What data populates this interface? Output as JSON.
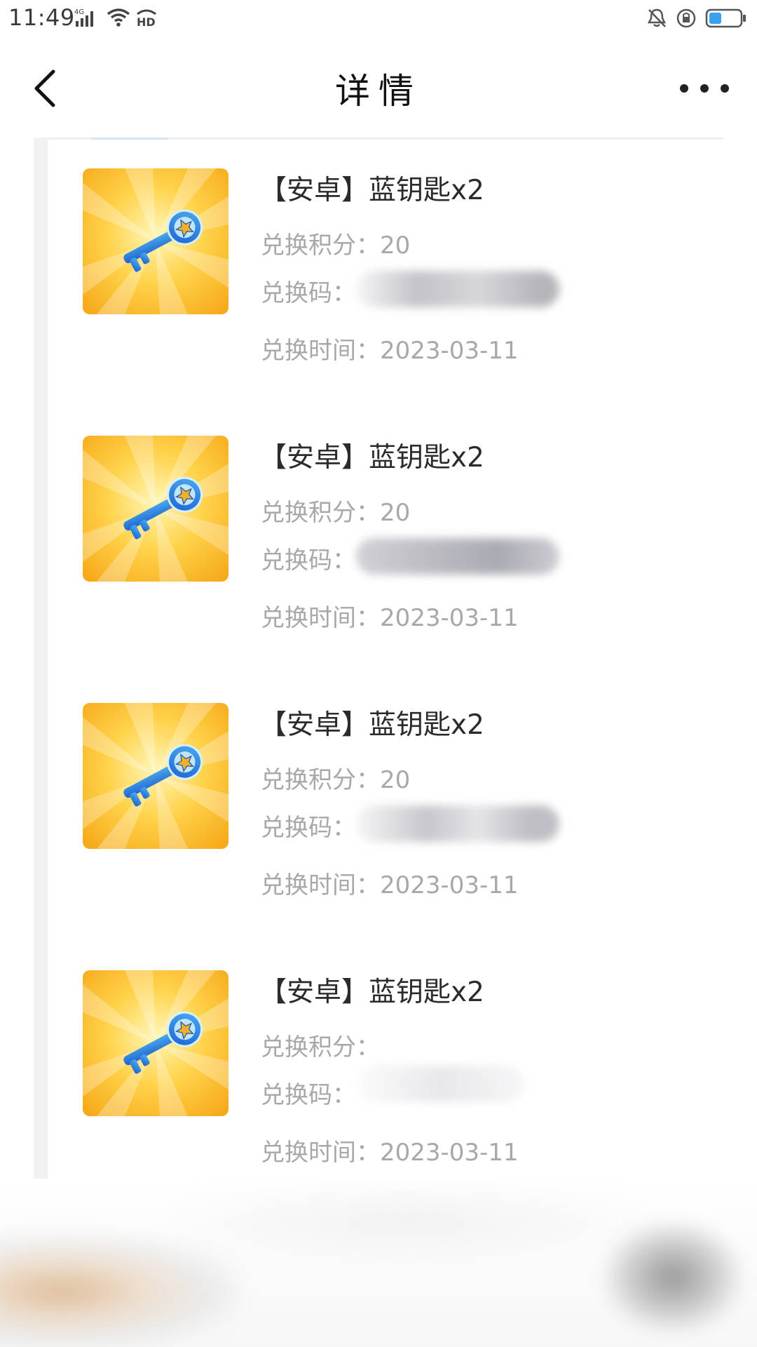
{
  "status_bar": {
    "time": "11:49",
    "network": "4G",
    "left_icons": [
      "signal-icon",
      "wifi-icon",
      "hd-icon"
    ],
    "right_icons": [
      "mute-bell-icon",
      "rotation-lock-icon",
      "battery-icon"
    ],
    "battery_level": 0.4
  },
  "header": {
    "back_icon": "chevron-left-icon",
    "title": "详情",
    "more_icon": "more-dots-icon"
  },
  "colors": {
    "accent": "#4a90e2",
    "thumb_bg": "#f8b41c",
    "key_blue": "#2e74d8"
  },
  "items": [
    {
      "title": "【安卓】蓝钥匙x2",
      "points_label": "兑换积分：",
      "points": "20",
      "code_label": "兑换码：",
      "code": "",
      "time_label": "兑换时间：",
      "time": "2023-03-11"
    },
    {
      "title": "【安卓】蓝钥匙x2",
      "points_label": "兑换积分：",
      "points": "20",
      "code_label": "兑换码：",
      "code": "",
      "time_label": "兑换时间：",
      "time": "2023-03-11"
    },
    {
      "title": "【安卓】蓝钥匙x2",
      "points_label": "兑换积分：",
      "points": "20",
      "code_label": "兑换码：",
      "code": "",
      "time_label": "兑换时间：",
      "time": "2023-03-11"
    },
    {
      "title": "【安卓】蓝钥匙x2",
      "points_label": "兑换积分：",
      "points": "",
      "code_label": "兑换码：",
      "code": "",
      "time_label": "兑换时间：",
      "time": "2023-03-11"
    }
  ]
}
